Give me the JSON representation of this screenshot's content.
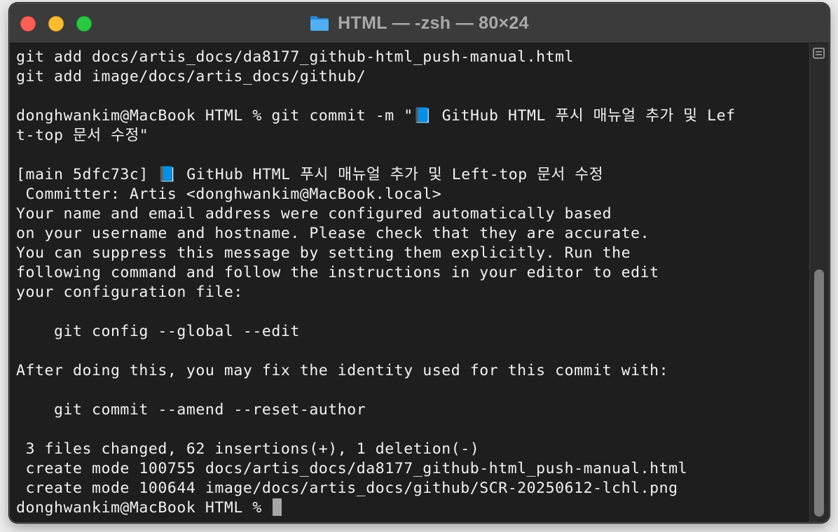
{
  "window": {
    "title": "HTML — -zsh — 80×24",
    "title_icon": "folder-icon"
  },
  "colors": {
    "background": "#1e1e1e",
    "text": "#f2f2f2",
    "titlebar": "#3b3b3b",
    "close": "#ff5f57",
    "minimize": "#febc2e",
    "zoom": "#28c840",
    "folder": "#3b9ff0"
  },
  "terminal": {
    "lines": [
      "git add docs/artis_docs/da8177_github-html_push-manual.html",
      "git add image/docs/artis_docs/github/",
      "",
      "donghwankim@MacBook HTML % git commit -m \"📘 GitHub HTML 푸시 매뉴얼 추가 및 Lef",
      "t-top 문서 수정\"",
      "",
      "[main 5dfc73c] 📘 GitHub HTML 푸시 매뉴얼 추가 및 Left-top 문서 수정",
      " Committer: Artis <donghwankim@MacBook.local>",
      "Your name and email address were configured automatically based",
      "on your username and hostname. Please check that they are accurate.",
      "You can suppress this message by setting them explicitly. Run the",
      "following command and follow the instructions in your editor to edit",
      "your configuration file:",
      "",
      "    git config --global --edit",
      "",
      "After doing this, you may fix the identity used for this commit with:",
      "",
      "    git commit --amend --reset-author",
      "",
      " 3 files changed, 62 insertions(+), 1 deletion(-)",
      " create mode 100755 docs/artis_docs/da8177_github-html_push-manual.html",
      " create mode 100644 image/docs/artis_docs/github/SCR-20250612-lchl.png"
    ],
    "prompt": "donghwankim@MacBook HTML % "
  }
}
